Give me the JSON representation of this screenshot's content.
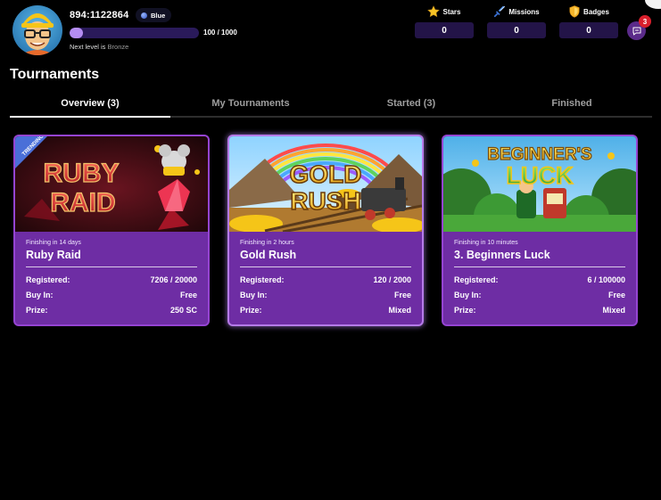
{
  "header": {
    "user_id": "894:1122864",
    "tier": "Blue",
    "xp_text": "100 / 1000",
    "xp_fraction": 0.1,
    "next_level_prefix": "Next level is",
    "next_level_name": "Bronze",
    "stats": [
      {
        "label": "Stars",
        "value": "0",
        "icon": "star-icon"
      },
      {
        "label": "Missions",
        "value": "0",
        "icon": "sword-icon"
      },
      {
        "label": "Badges",
        "value": "0",
        "icon": "shield-icon"
      }
    ],
    "chat_count": "3"
  },
  "page": {
    "title": "Tournaments",
    "tabs": [
      {
        "label": "Overview (3)",
        "active": true
      },
      {
        "label": "My Tournaments",
        "active": false
      },
      {
        "label": "Started (3)",
        "active": false
      },
      {
        "label": "Finished",
        "active": false
      }
    ]
  },
  "cards": [
    {
      "banner_text": [
        "RUBY",
        "RAID"
      ],
      "ribbon": "TRENDING",
      "finishing": "Finishing in 14 days",
      "title": "Ruby Raid",
      "rows": [
        {
          "label": "Registered:",
          "value": "7206 / 20000"
        },
        {
          "label": "Buy In:",
          "value": "Free"
        },
        {
          "label": "Prize:",
          "value": "250 SC"
        }
      ]
    },
    {
      "banner_text": [
        "GOLD",
        "RUSH"
      ],
      "finishing": "Finishing in 2 hours",
      "title": "Gold Rush",
      "rows": [
        {
          "label": "Registered:",
          "value": "120 / 2000"
        },
        {
          "label": "Buy In:",
          "value": "Free"
        },
        {
          "label": "Prize:",
          "value": "Mixed"
        }
      ]
    },
    {
      "banner_text": [
        "BEGINNER'S",
        "LUCK"
      ],
      "finishing": "Finishing in 10 minutes",
      "title": "3. Beginners Luck",
      "rows": [
        {
          "label": "Registered:",
          "value": "6 / 100000"
        },
        {
          "label": "Buy In:",
          "value": "Free"
        },
        {
          "label": "Prize:",
          "value": "Mixed"
        }
      ]
    }
  ]
}
